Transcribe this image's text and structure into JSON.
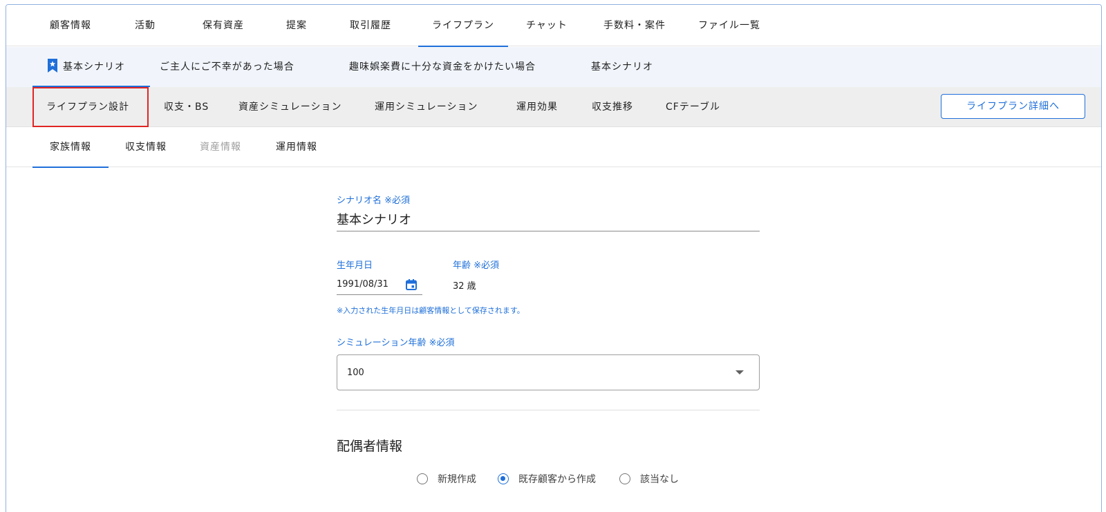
{
  "top_tabs": [
    {
      "label": "顧客情報"
    },
    {
      "label": "活動"
    },
    {
      "label": "保有資産"
    },
    {
      "label": "提案"
    },
    {
      "label": "取引履歴"
    },
    {
      "label": "ライフプラン"
    },
    {
      "label": "チャット"
    },
    {
      "label": "手数料・案件"
    },
    {
      "label": "ファイル一覧"
    }
  ],
  "top_tabs_active": "ライフプラン",
  "scenario_tabs": [
    {
      "label": "基本シナリオ",
      "icon": "bookmark-star-icon"
    },
    {
      "label": "ご主人にご不幸があった場合"
    },
    {
      "label": "趣味娯楽費に十分な資金をかけたい場合"
    },
    {
      "label": "基本シナリオ"
    }
  ],
  "sub_tabs": [
    {
      "label": "ライフプラン設計"
    },
    {
      "label": "収支・BS"
    },
    {
      "label": "資産シミュレーション"
    },
    {
      "label": "運用シミュレーション"
    },
    {
      "label": "運用効果"
    },
    {
      "label": "収支推移"
    },
    {
      "label": "CFテーブル"
    }
  ],
  "detail_button": "ライフプラン詳細へ",
  "info_tabs": [
    {
      "label": "家族情報"
    },
    {
      "label": "収支情報"
    },
    {
      "label": "資産情報"
    },
    {
      "label": "運用情報"
    }
  ],
  "form": {
    "scenario_name_label": "シナリオ名 ※必須",
    "scenario_name_value": "基本シナリオ",
    "birthdate_label": "生年月日",
    "birthdate_value": "1991/08/31",
    "age_label": "年齢 ※必須",
    "age_value": "32 歳",
    "birthdate_note": "※入力された生年月日は顧客情報として保存されます。",
    "sim_age_label": "シミュレーション年齢 ※必須",
    "sim_age_value": "100",
    "spouse_section_title": "配偶者情報",
    "spouse_options": [
      {
        "label": "新規作成",
        "checked": false
      },
      {
        "label": "既存顧客から作成",
        "checked": true
      },
      {
        "label": "該当なし",
        "checked": false
      }
    ]
  },
  "colors": {
    "accent": "#1e6fd9",
    "highlight": "#e02424",
    "scenario_bg": "#f1f5fb",
    "subtab_bg": "#eeeeee"
  }
}
